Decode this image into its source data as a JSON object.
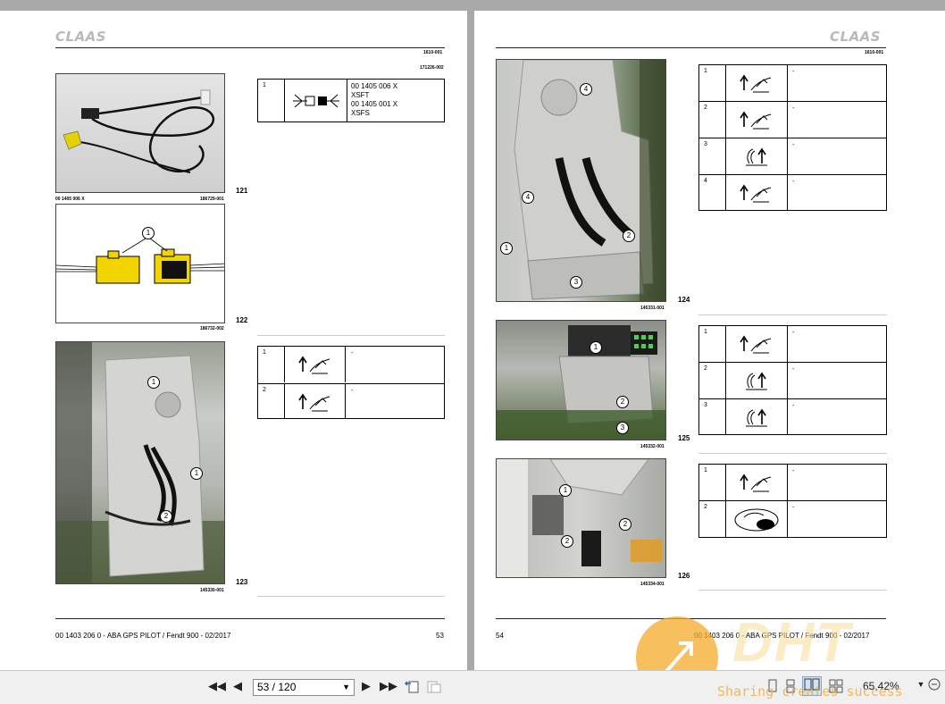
{
  "left_page": {
    "brand": "CLAAS",
    "doc_code": "1610-001",
    "doc_code2": "171226-002",
    "fig121": {
      "number": "121",
      "part_caption": "00 1405 006 X",
      "image_code": "186729-001"
    },
    "fig122": {
      "number": "122",
      "image_code": "186732-002",
      "callout": "1"
    },
    "fig123": {
      "number": "123",
      "image_code": "145330-001",
      "callouts": [
        "1",
        "1",
        "2"
      ]
    },
    "table1": {
      "rows": [
        {
          "num": "1",
          "lines": [
            "00 1405 006 X",
            "XSFT",
            "00 1405 001 X",
            "XSFS"
          ],
          "icon": "connector-icon"
        }
      ]
    },
    "table2": {
      "rows": [
        {
          "num": "1",
          "text": "-",
          "icon": "hand-up-arrow-icon"
        },
        {
          "num": "2",
          "text": "-",
          "icon": "hand-up-arrow-icon"
        }
      ]
    },
    "footer_title": "00 1403 206 0 - ABA GPS PILOT / Fendt 900 - 02/2017",
    "page_number": "53"
  },
  "right_page": {
    "brand": "CLAAS",
    "doc_code": "1610-001",
    "fig124": {
      "number": "124",
      "image_code": "145331-001",
      "callouts": [
        "4",
        "4",
        "1",
        "2",
        "3"
      ]
    },
    "fig125": {
      "number": "125",
      "image_code": "145332-001",
      "callouts": [
        "1",
        "2",
        "3"
      ]
    },
    "fig126": {
      "number": "126",
      "image_code": "145334-001",
      "callouts": [
        "1",
        "2",
        "2"
      ]
    },
    "table3": {
      "rows": [
        {
          "num": "1",
          "text": "-",
          "icon": "hand-up-arrow-icon"
        },
        {
          "num": "2",
          "text": "-",
          "icon": "hand-up-arrow-icon"
        },
        {
          "num": "3",
          "text": "-",
          "icon": "clip-release-icon"
        },
        {
          "num": "4",
          "text": "-",
          "icon": "hand-up-arrow-icon"
        }
      ]
    },
    "table4": {
      "rows": [
        {
          "num": "1",
          "text": "-",
          "icon": "hand-up-arrow-icon"
        },
        {
          "num": "2",
          "text": "-",
          "icon": "clip-release-icon"
        },
        {
          "num": "3",
          "text": "-",
          "icon": "clip-release-icon"
        }
      ]
    },
    "table5": {
      "rows": [
        {
          "num": "1",
          "text": "-",
          "icon": "hand-up-arrow-icon"
        },
        {
          "num": "2",
          "text": "-",
          "icon": "wipe-hand-icon"
        }
      ]
    },
    "page_number": "54",
    "footer_title": "00 1403 206 0 - ABA GPS PILOT / Fendt 900 - 02/2017"
  },
  "toolbar": {
    "page_field": "53 / 120",
    "zoom": "65,42%"
  },
  "watermark": {
    "text": "DHT",
    "slogan": "Sharing creates success"
  }
}
